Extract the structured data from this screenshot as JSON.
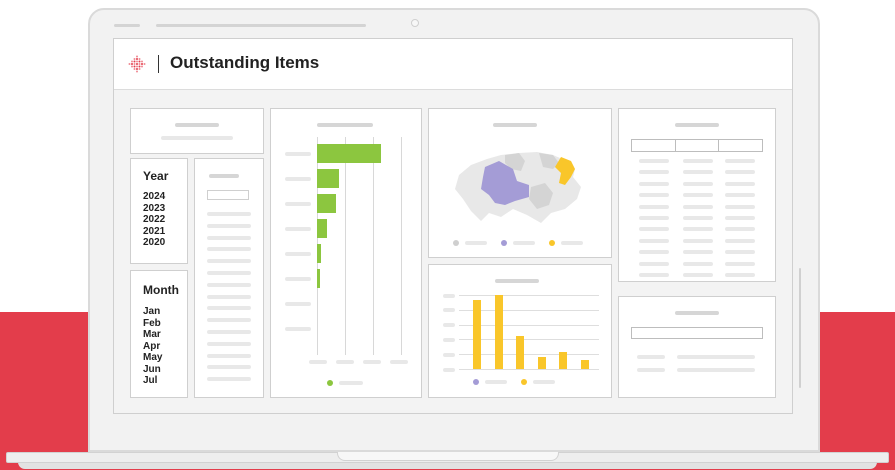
{
  "app": {
    "title": "Outstanding Items",
    "logo_icon": "diamond-logo-icon",
    "accent_red": "#e33d4b"
  },
  "filters": {
    "year": {
      "title": "Year",
      "options": [
        "2024",
        "2023",
        "2022",
        "2021",
        "2020"
      ]
    },
    "month": {
      "title": "Month",
      "options": [
        "Jan",
        "Feb",
        "Mar",
        "Apr",
        "May",
        "Jun",
        "Jul"
      ]
    }
  },
  "map": {
    "type": "choropleth",
    "legend_colors": [
      "#cfcfcf",
      "#a49cd6",
      "#f9c62a"
    ]
  },
  "chart_data": [
    {
      "type": "bar",
      "orientation": "horizontal",
      "color": "#8cc63f",
      "categories": [
        "",
        "",
        "",
        "",
        "",
        "",
        "",
        ""
      ],
      "values": [
        100,
        34,
        29,
        15,
        7,
        5,
        0,
        0
      ],
      "xlim": [
        0,
        100
      ],
      "grid": true,
      "legend_colors": [
        "#8cc63f"
      ]
    },
    {
      "type": "bar",
      "orientation": "vertical",
      "color": "#f9c62a",
      "categories": [
        "",
        "",
        "",
        "",
        "",
        ""
      ],
      "values": [
        88,
        95,
        42,
        16,
        22,
        11
      ],
      "ylim": [
        0,
        100
      ],
      "grid": true,
      "legend_colors": [
        "#a49cd6",
        "#f9c62a"
      ]
    }
  ]
}
